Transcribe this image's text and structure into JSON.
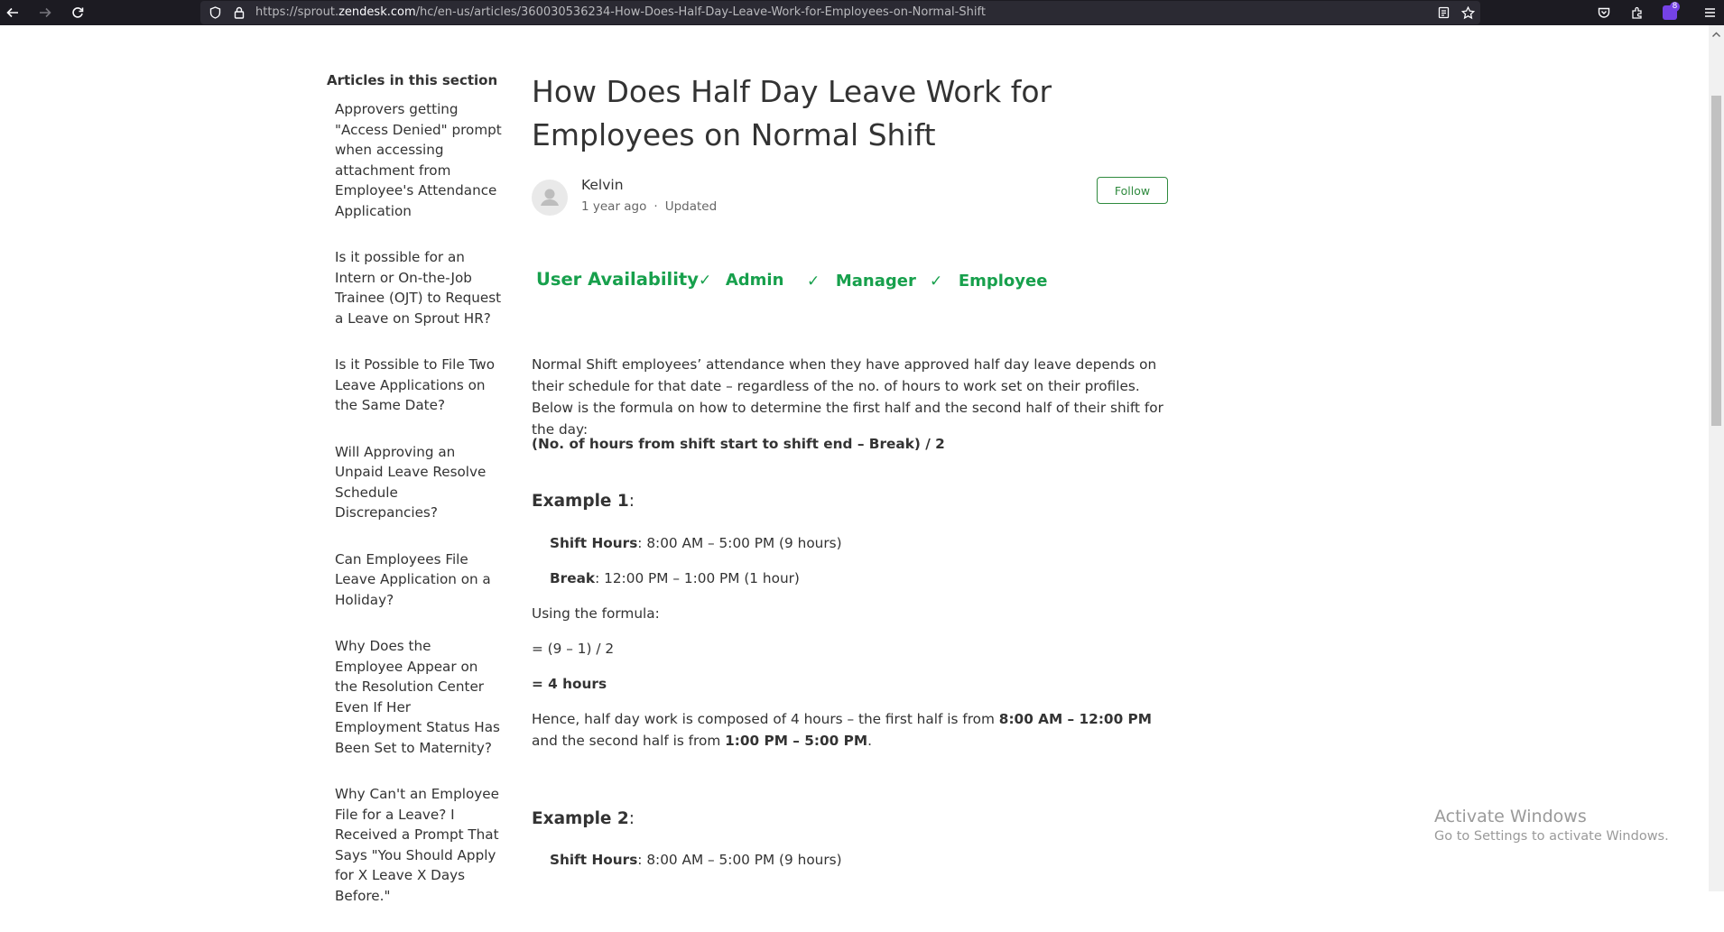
{
  "browser": {
    "url_prefix": "https://sprout.",
    "url_domain": "zendesk.com",
    "url_path": "/hc/en-us/articles/360030536234-How-Does-Half-Day-Leave-Work-for-Employees-on-Normal-Shift",
    "extensions_badge": "8"
  },
  "sidebar": {
    "title": "Articles in this section",
    "items": [
      {
        "label": "Approvers getting \"Access Denied\" prompt when accessing attachment from Employee's Attendance Application"
      },
      {
        "label": "Is it possible for an Intern or On-the-Job Trainee (OJT) to Request a Leave on Sprout HR?"
      },
      {
        "label": "Is it Possible to File Two Leave Applications on the Same Date?"
      },
      {
        "label": "Will Approving an Unpaid Leave Resolve Schedule Discrepancies?"
      },
      {
        "label": "Can Employees File Leave Application on a Holiday?"
      },
      {
        "label": "Why Does the Employee Appear on the Resolution Center Even If Her Employment Status Has Been Set to Maternity?"
      },
      {
        "label": "Why Can't an Employee File for a Leave? I Received a Prompt That Says \"You Should Apply for X Leave X Days Before.\""
      }
    ]
  },
  "article": {
    "title": "How Does Half Day Leave Work for Employees on Normal Shift",
    "author": "Kelvin",
    "posted": "1 year ago",
    "meta_separator": "·",
    "updated": "Updated",
    "follow_label": "Follow",
    "availability": {
      "label": "User Availability",
      "check": "✓",
      "roles": [
        "Admin",
        "Manager",
        "Employee"
      ]
    },
    "intro": "Normal Shift employees’ attendance when they have approved half day leave depends on their schedule for that date – regardless of the no. of hours to work set on their profiles. Below is the formula on how to determine the first half and the second half of their shift for the day:",
    "formula": "(No. of hours from shift start to shift end – Break) / 2",
    "example1": {
      "heading": "Example 1",
      "shift_label": "Shift Hours",
      "shift_value": ": 8:00 AM – 5:00 PM (9 hours)",
      "break_label": "Break",
      "break_value": ": 12:00 PM – 1:00 PM (1 hour)",
      "using": "Using the formula:",
      "calc": "= (9 – 1) / 2",
      "result": "= 4 hours",
      "hence_1": "Hence, half day work is composed of 4 hours – the first half is from ",
      "hence_b1": "8:00 AM – 12:00 PM",
      "hence_2": " and the second half is from ",
      "hence_b2": "1:00 PM – 5:00 PM",
      "hence_3": "."
    },
    "example2": {
      "heading": "Example 2",
      "shift_label": "Shift Hours",
      "shift_value": ": 8:00 AM – 5:00 PM (9 hours)"
    },
    "colon": ":"
  },
  "watermark": {
    "line1": "Activate Windows",
    "line2": "Go to Settings to activate Windows."
  }
}
